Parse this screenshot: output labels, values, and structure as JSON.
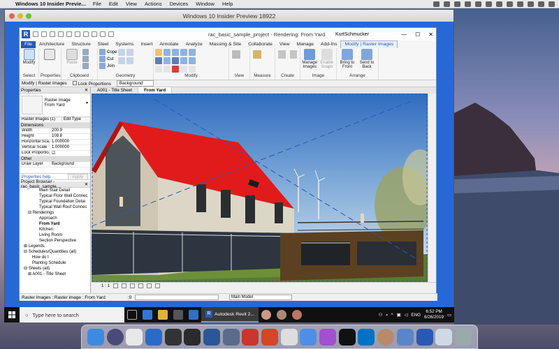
{
  "mac_menubar": {
    "app": "Windows 10 Insider Previe...",
    "menus": [
      "File",
      "Edit",
      "View",
      "Actions",
      "Devices",
      "Window",
      "Help"
    ]
  },
  "vm_window": {
    "title": "Windows 10 Insider Preview 18922"
  },
  "revit": {
    "doc_title": "rac_basic_sample_project - Rendering: From Yard",
    "user": "KurtSchmucker",
    "tabs": [
      "File",
      "Architecture",
      "Structure",
      "Steel",
      "Systems",
      "Insert",
      "Annotate",
      "Analyze",
      "Massing & Site",
      "Collaborate",
      "View",
      "Manage",
      "Add-Ins",
      "Modify | Raster Images"
    ],
    "ribbon": {
      "select_label": "Select",
      "modify_btn": "Modify",
      "properties_label": "Properties",
      "clipboard_label": "Clipboard",
      "paste": "Paste",
      "copy": "Cope",
      "cut": "Cut",
      "join": "Join",
      "geometry_label": "Geometry",
      "modify_label": "Modify",
      "view_label": "View",
      "measure_label": "Measure",
      "create_label": "Create",
      "manage_images": "Manage Images",
      "enable_snaps": "Enable Snaps",
      "bring_to_front": "Bring to Front",
      "send_to_back": "Send to Back",
      "image_label": "Image",
      "arrange_label": "Arrange"
    },
    "options_bar": {
      "context": "Modify | Raster Images",
      "lock_proportions": "Lock Proportions",
      "background": "Background"
    },
    "properties": {
      "header": "Properties",
      "type_line1": "Raster image",
      "type_line2": "From Yard",
      "selector": "Raster Images (1)",
      "edit_type": "Edit Type",
      "section_dimensions": "Dimensions",
      "rows": [
        {
          "k": "Width",
          "v": "200.9"
        },
        {
          "k": "Height",
          "v": "109.8"
        },
        {
          "k": "Horizontal Sca...",
          "v": "1.000000"
        },
        {
          "k": "Vertical Scale",
          "v": "1.000000"
        },
        {
          "k": "Lock Proportio...",
          "v": "☑"
        }
      ],
      "section_other": "Other",
      "draw_layer_k": "Draw Layer",
      "draw_layer_v": "Background",
      "help": "Properties help",
      "apply": "Apply"
    },
    "browser": {
      "header": "Project Browser - rac_basic_sample...",
      "nodes": [
        "Main Stair Detail",
        "Typical Floor Wall Connec",
        "Typical Foundation Detai",
        "Typical Wall Roof Connec",
        "Renderings",
        "Approach",
        "From Yard",
        "Kitchen",
        "Living Room",
        "Section Perspective",
        "Legends",
        "Schedules/Quantities (all)",
        "How do I",
        "Planting Schedule",
        "Sheets (all)",
        "A001 - Title Sheet"
      ]
    },
    "view_tabs": [
      "A001 - Title Sheet",
      "From Yard"
    ],
    "view_scale": "1 : 1",
    "status_text": "Raster Images : Raster image : From Yard",
    "status_zero": ":0",
    "status_model": "Main Model"
  },
  "win_taskbar": {
    "search": "Type here to search",
    "revit_task": "Autodesk Revit 2...",
    "lang": "ENG",
    "time": "6:52 PM",
    "date": "6/26/2019"
  },
  "colors": {
    "revit_blue": "#2a58b5",
    "win_blue": "#2768d6",
    "roof_red": "#e11b1b"
  }
}
